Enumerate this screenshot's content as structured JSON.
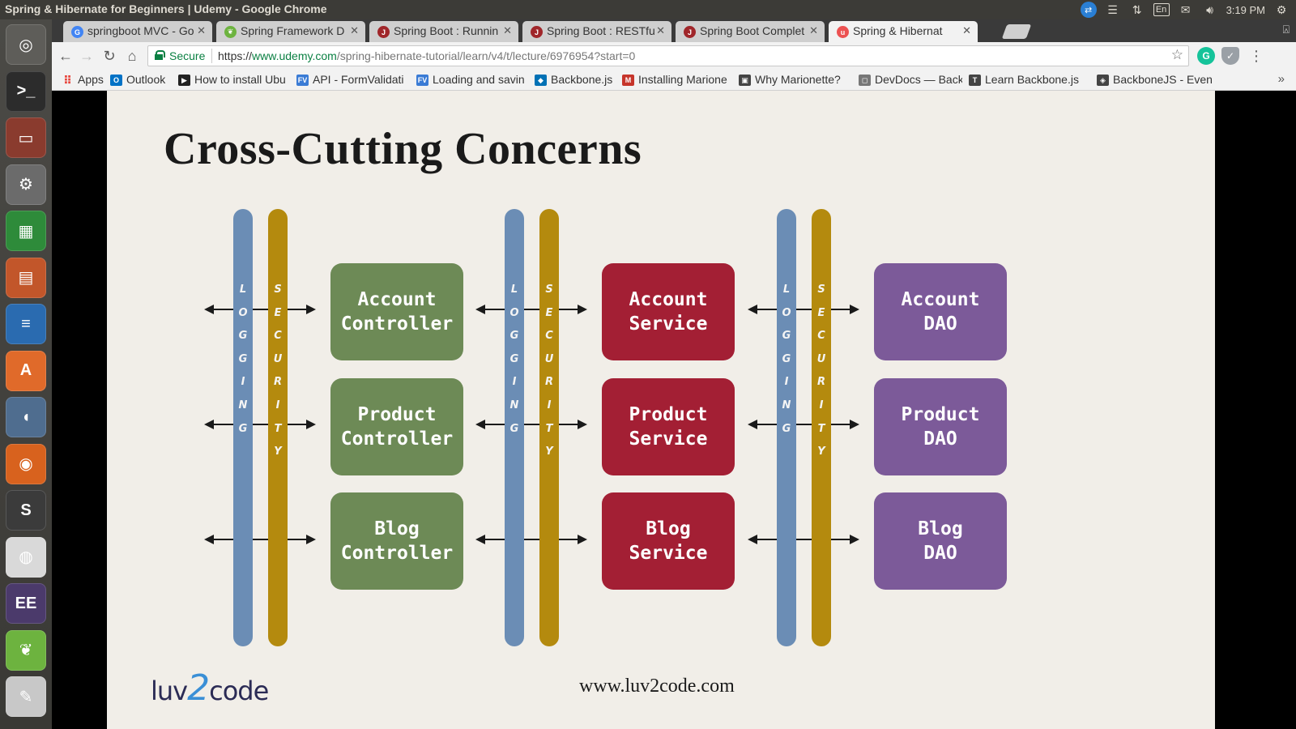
{
  "os": {
    "window_title": "Spring & Hibernate for Beginners | Udemy - Google Chrome",
    "clock": "3:19 PM",
    "keyboard_layout": "En"
  },
  "launcher": {
    "apps": [
      {
        "name": "ubuntu-dash",
        "color": "#5e5d59",
        "glyph": "◎"
      },
      {
        "name": "terminal",
        "color": "#2c2c2c",
        "glyph": ">_"
      },
      {
        "name": "files",
        "color": "#8a3b2e",
        "glyph": "▭"
      },
      {
        "name": "system-settings",
        "color": "#6b6b6b",
        "glyph": "⚙"
      },
      {
        "name": "calc-spreadsheet",
        "color": "#2e8b3a",
        "glyph": "▦"
      },
      {
        "name": "impress-presentation",
        "color": "#c2562a",
        "glyph": "▤"
      },
      {
        "name": "writer-document",
        "color": "#2a6bb0",
        "glyph": "≡"
      },
      {
        "name": "software-center",
        "color": "#e06a2a",
        "glyph": "A"
      },
      {
        "name": "pgadmin-elephant",
        "color": "#4f6d8f",
        "glyph": "◖"
      },
      {
        "name": "firefox",
        "color": "#d8621e",
        "glyph": "◉"
      },
      {
        "name": "sublime-text",
        "color": "#3b3b3b",
        "glyph": "S"
      },
      {
        "name": "chrome",
        "color": "#d9d9d9",
        "glyph": "◍"
      },
      {
        "name": "eclipse-java-ee",
        "color": "#4b3a6b",
        "glyph": "EE"
      },
      {
        "name": "spring-tool-suite",
        "color": "#6db33f",
        "glyph": "❦"
      },
      {
        "name": "text-editor",
        "color": "#c8c8c8",
        "glyph": "✎"
      }
    ]
  },
  "tabs": [
    {
      "title": "springboot MVC - Go",
      "favicon": "G",
      "fav_color": "#4285f4"
    },
    {
      "title": "Spring Framework D",
      "favicon": "❦",
      "fav_color": "#6db33f"
    },
    {
      "title": "Spring Boot : Runnin",
      "favicon": "J",
      "fav_color": "#a0262a"
    },
    {
      "title": "Spring Boot : RESTfu",
      "favicon": "J",
      "fav_color": "#a0262a"
    },
    {
      "title": "Spring Boot Complet",
      "favicon": "J",
      "fav_color": "#a0262a"
    },
    {
      "title": "Spring & Hibernat",
      "favicon": "u",
      "fav_color": "#ec5252",
      "active": true
    }
  ],
  "address_bar": {
    "secure_label": "Secure",
    "url_scheme": "https://",
    "url_host": "www.udemy.com",
    "url_path": "/spring-hibernate-tutorial/learn/v4/t/lecture/6976954?start=0"
  },
  "bookmarks": [
    {
      "label": "Apps",
      "icon": "apps-grid",
      "color": "#e8453c"
    },
    {
      "label": "Outlook",
      "icon": "O",
      "color": "#0072c6"
    },
    {
      "label": "How to install Ubu",
      "icon": "▶",
      "color": "#222"
    },
    {
      "label": "API - FormValidati",
      "icon": "FV",
      "color": "#3a7bd5"
    },
    {
      "label": "Loading and savin",
      "icon": "FV",
      "color": "#3a7bd5"
    },
    {
      "label": "Backbone.js",
      "icon": "◆",
      "color": "#0071b5"
    },
    {
      "label": "Installing Marione",
      "icon": "M",
      "color": "#c6352b"
    },
    {
      "label": "Why Marionette?",
      "icon": "▣",
      "color": "#444"
    },
    {
      "label": "DevDocs — Backb",
      "icon": "◻",
      "color": "#777"
    },
    {
      "label": "Learn Backbone.js",
      "icon": "T",
      "color": "#444"
    },
    {
      "label": "BackboneJS - Even",
      "icon": "◈",
      "color": "#444"
    }
  ],
  "slide": {
    "title": "Cross-Cutting Concerns",
    "logging_label": [
      "L",
      "O",
      "G",
      "G",
      "I",
      "N",
      "G"
    ],
    "security_label": [
      "S",
      "E",
      "C",
      "U",
      "R",
      "I",
      "T",
      "Y"
    ],
    "controllers": [
      "Account\nController",
      "Product\nController",
      "Blog\nController"
    ],
    "services": [
      "Account\nService",
      "Product\nService",
      "Blog\nService"
    ],
    "daos": [
      "Account\nDAO",
      "Product\nDAO",
      "Blog\nDAO"
    ],
    "colors": {
      "logging": "#6b8db5",
      "security": "#b48a0e",
      "controller": "#6d8a56",
      "service": "#a31f34",
      "dao": "#7c5a99"
    },
    "logo_prefix": "luv",
    "logo_two": "2",
    "logo_suffix": "code",
    "footer_url": "www.luv2code.com"
  }
}
